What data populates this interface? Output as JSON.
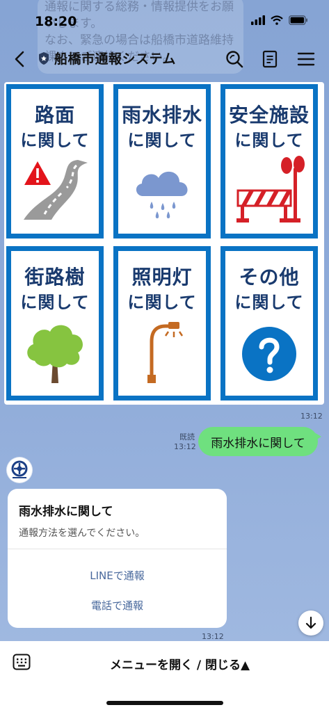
{
  "status": {
    "time": "18:20"
  },
  "ghost_message": "通報に関する総務・情報提供をお願いします。\nなお、緊急の場合は船橋市道路維持課までご連絡ください。",
  "header": {
    "title": "船橋市通報システム"
  },
  "menu": {
    "tiles": [
      {
        "line1": "路面",
        "line2": "に関して",
        "icon": "road-warning-icon"
      },
      {
        "line1": "雨水排水",
        "line2": "に関して",
        "icon": "rain-cloud-icon"
      },
      {
        "line1": "安全施設",
        "line2": "に関して",
        "icon": "barrier-icon"
      },
      {
        "line1": "街路樹",
        "line2": "に関して",
        "icon": "tree-icon"
      },
      {
        "line1": "照明灯",
        "line2": "に関して",
        "icon": "streetlight-icon"
      },
      {
        "line1": "その他",
        "line2": "に関して",
        "icon": "question-icon"
      }
    ],
    "time": "13:12"
  },
  "sent": {
    "read": "既読",
    "time": "13:12",
    "text": "雨水排水に関して"
  },
  "card": {
    "title": "雨水排水に関して",
    "subtitle": "通報方法を選んでください。",
    "buttons": [
      "LINEで通報",
      "電話で通報"
    ],
    "time": "13:12"
  },
  "bottom": {
    "menu_label": "メニューを開く / 閉じる▲"
  },
  "colors": {
    "tile_border": "#0a73c4",
    "sent_bubble": "#6fe07f",
    "link": "#48689c"
  }
}
